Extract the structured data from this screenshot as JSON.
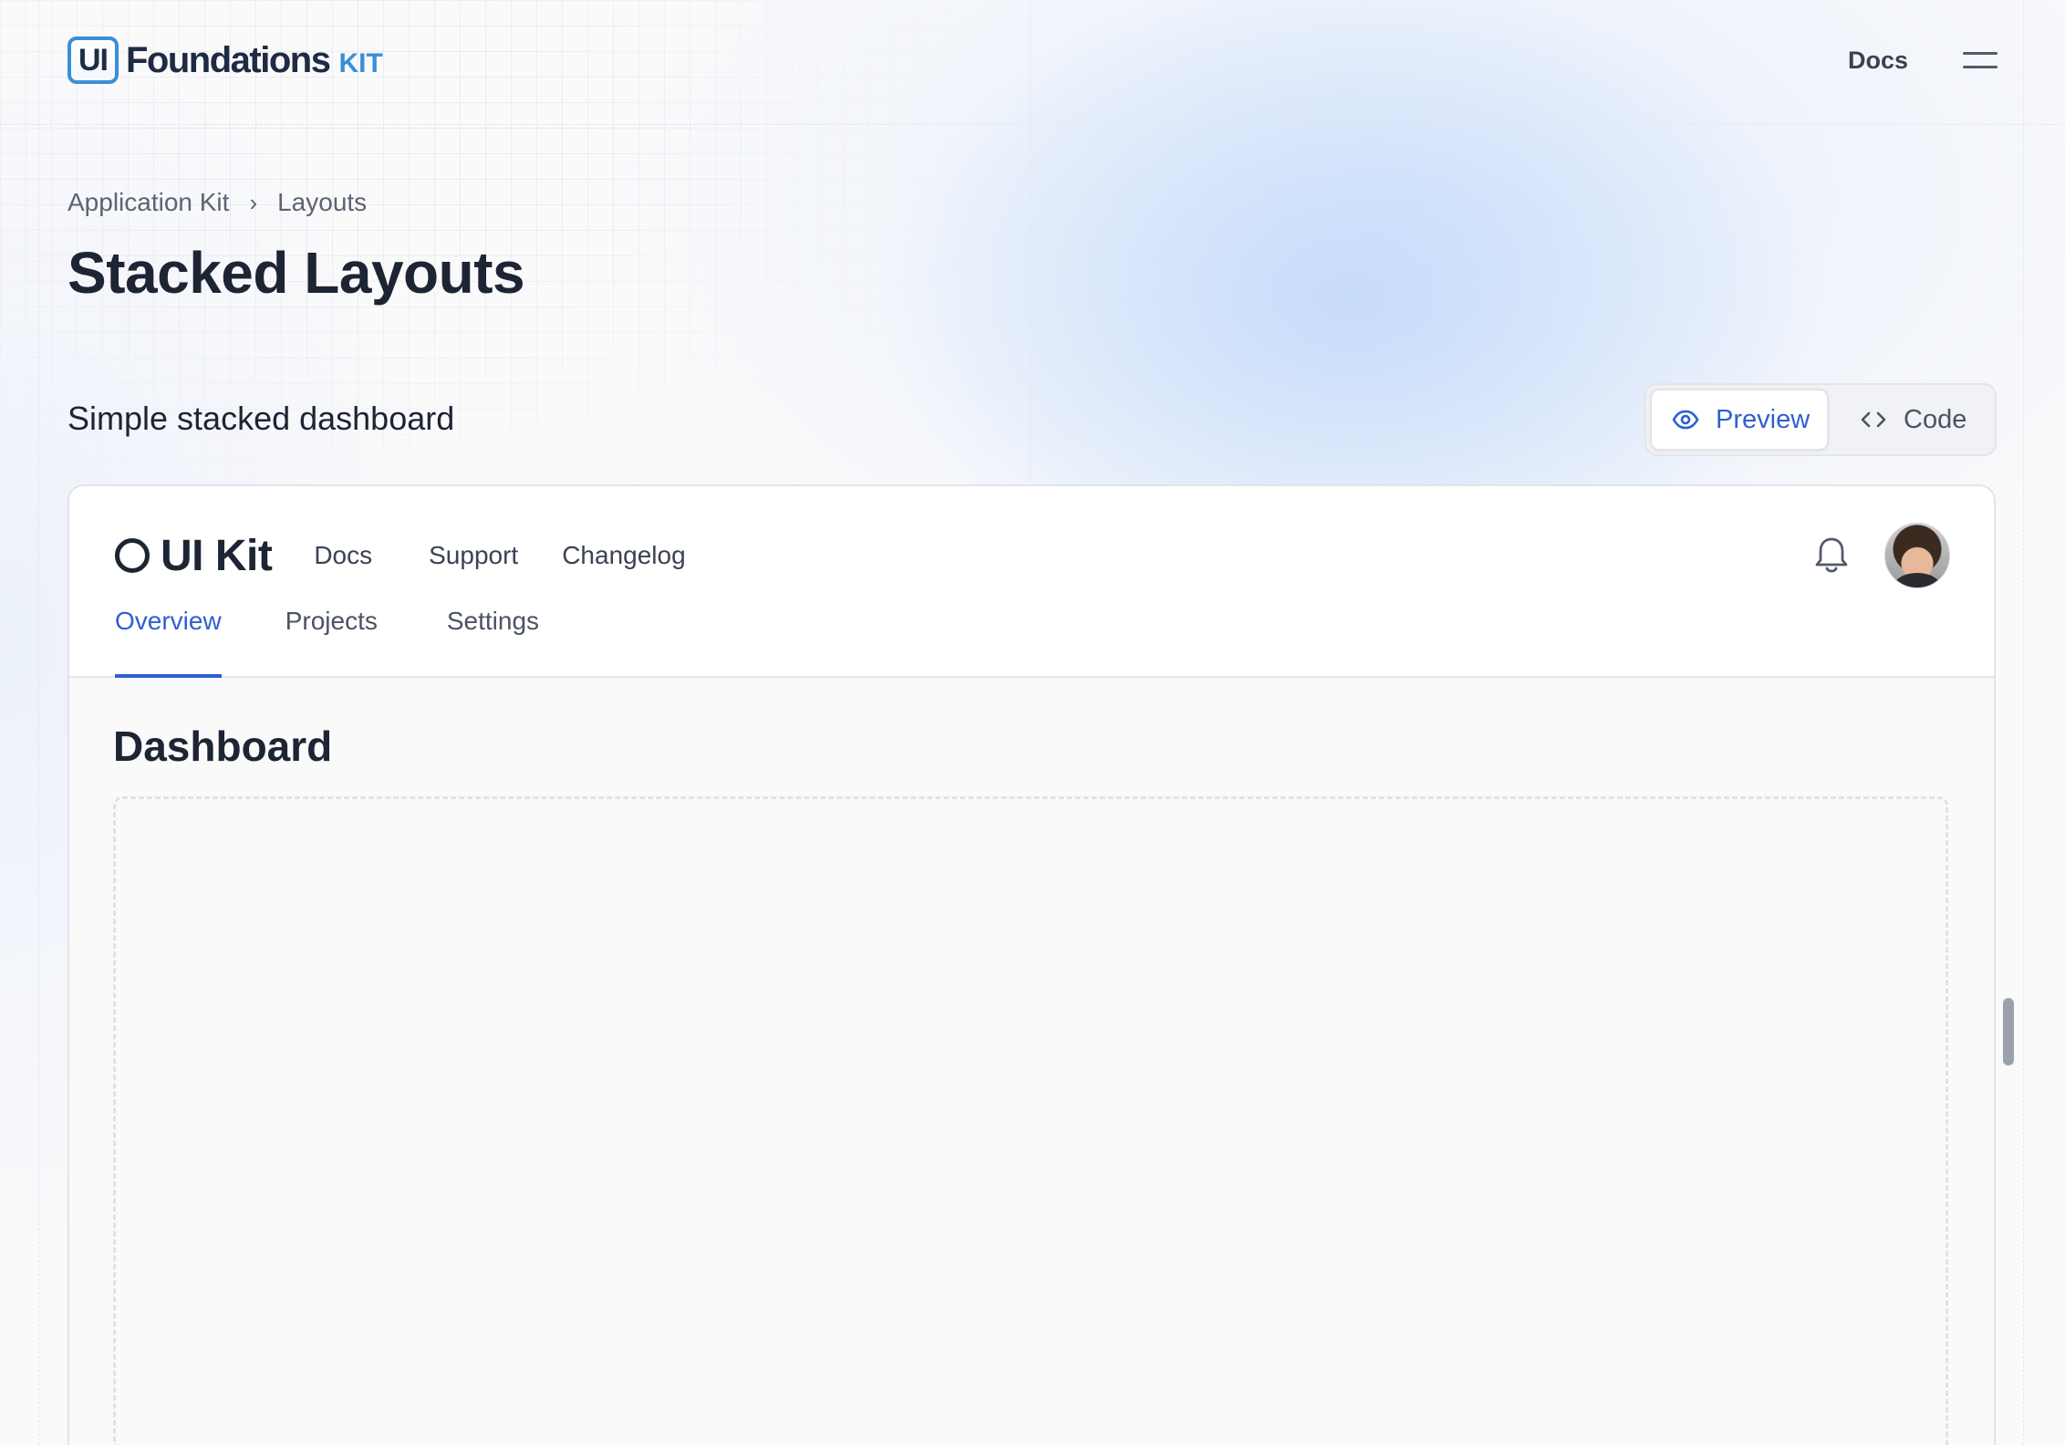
{
  "brand": {
    "mark": "UI",
    "name": "Foundations",
    "suffix": "KIT"
  },
  "topnav": {
    "docs_label": "Docs",
    "menu_icon": "hamburger-icon"
  },
  "breadcrumb": {
    "items": [
      "Application Kit",
      "Layouts"
    ],
    "separator": "›"
  },
  "page_title": "Stacked Layouts",
  "section": {
    "title": "Simple stacked dashboard",
    "toggle": {
      "preview_label": "Preview",
      "code_label": "Code",
      "active": "Preview"
    }
  },
  "preview_app": {
    "logo_text": "UI Kit",
    "links": [
      "Docs",
      "Support",
      "Changelog"
    ],
    "tabs": [
      "Overview",
      "Projects",
      "Settings"
    ],
    "active_tab": "Overview",
    "page_heading": "Dashboard"
  },
  "colors": {
    "accent": "#2f5fd0",
    "brand": "#3b8fd6",
    "text": "#1d2433"
  }
}
